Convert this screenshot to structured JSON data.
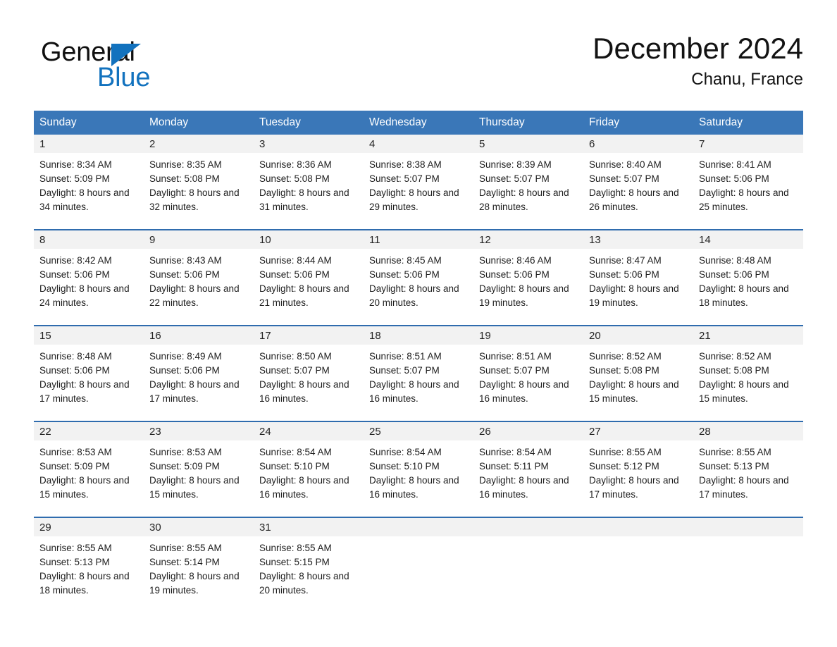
{
  "brand": {
    "word_one": "General",
    "word_two": "Blue",
    "triangle_color": "#1272be"
  },
  "header": {
    "title": "December 2024",
    "subtitle": "Chanu, France"
  },
  "theme": {
    "header_blue": "#3a77b8",
    "row_rule_blue": "#2f6cae",
    "daynum_band": "#f2f2f2"
  },
  "weekdays": [
    "Sunday",
    "Monday",
    "Tuesday",
    "Wednesday",
    "Thursday",
    "Friday",
    "Saturday"
  ],
  "weeks": [
    [
      {
        "day": "1",
        "info": "Sunrise: 8:34 AM\nSunset: 5:09 PM\nDaylight: 8 hours and 34 minutes."
      },
      {
        "day": "2",
        "info": "Sunrise: 8:35 AM\nSunset: 5:08 PM\nDaylight: 8 hours and 32 minutes."
      },
      {
        "day": "3",
        "info": "Sunrise: 8:36 AM\nSunset: 5:08 PM\nDaylight: 8 hours and 31 minutes."
      },
      {
        "day": "4",
        "info": "Sunrise: 8:38 AM\nSunset: 5:07 PM\nDaylight: 8 hours and 29 minutes."
      },
      {
        "day": "5",
        "info": "Sunrise: 8:39 AM\nSunset: 5:07 PM\nDaylight: 8 hours and 28 minutes."
      },
      {
        "day": "6",
        "info": "Sunrise: 8:40 AM\nSunset: 5:07 PM\nDaylight: 8 hours and 26 minutes."
      },
      {
        "day": "7",
        "info": "Sunrise: 8:41 AM\nSunset: 5:06 PM\nDaylight: 8 hours and 25 minutes."
      }
    ],
    [
      {
        "day": "8",
        "info": "Sunrise: 8:42 AM\nSunset: 5:06 PM\nDaylight: 8 hours and 24 minutes."
      },
      {
        "day": "9",
        "info": "Sunrise: 8:43 AM\nSunset: 5:06 PM\nDaylight: 8 hours and 22 minutes."
      },
      {
        "day": "10",
        "info": "Sunrise: 8:44 AM\nSunset: 5:06 PM\nDaylight: 8 hours and 21 minutes."
      },
      {
        "day": "11",
        "info": "Sunrise: 8:45 AM\nSunset: 5:06 PM\nDaylight: 8 hours and 20 minutes."
      },
      {
        "day": "12",
        "info": "Sunrise: 8:46 AM\nSunset: 5:06 PM\nDaylight: 8 hours and 19 minutes."
      },
      {
        "day": "13",
        "info": "Sunrise: 8:47 AM\nSunset: 5:06 PM\nDaylight: 8 hours and 19 minutes."
      },
      {
        "day": "14",
        "info": "Sunrise: 8:48 AM\nSunset: 5:06 PM\nDaylight: 8 hours and 18 minutes."
      }
    ],
    [
      {
        "day": "15",
        "info": "Sunrise: 8:48 AM\nSunset: 5:06 PM\nDaylight: 8 hours and 17 minutes."
      },
      {
        "day": "16",
        "info": "Sunrise: 8:49 AM\nSunset: 5:06 PM\nDaylight: 8 hours and 17 minutes."
      },
      {
        "day": "17",
        "info": "Sunrise: 8:50 AM\nSunset: 5:07 PM\nDaylight: 8 hours and 16 minutes."
      },
      {
        "day": "18",
        "info": "Sunrise: 8:51 AM\nSunset: 5:07 PM\nDaylight: 8 hours and 16 minutes."
      },
      {
        "day": "19",
        "info": "Sunrise: 8:51 AM\nSunset: 5:07 PM\nDaylight: 8 hours and 16 minutes."
      },
      {
        "day": "20",
        "info": "Sunrise: 8:52 AM\nSunset: 5:08 PM\nDaylight: 8 hours and 15 minutes."
      },
      {
        "day": "21",
        "info": "Sunrise: 8:52 AM\nSunset: 5:08 PM\nDaylight: 8 hours and 15 minutes."
      }
    ],
    [
      {
        "day": "22",
        "info": "Sunrise: 8:53 AM\nSunset: 5:09 PM\nDaylight: 8 hours and 15 minutes."
      },
      {
        "day": "23",
        "info": "Sunrise: 8:53 AM\nSunset: 5:09 PM\nDaylight: 8 hours and 15 minutes."
      },
      {
        "day": "24",
        "info": "Sunrise: 8:54 AM\nSunset: 5:10 PM\nDaylight: 8 hours and 16 minutes."
      },
      {
        "day": "25",
        "info": "Sunrise: 8:54 AM\nSunset: 5:10 PM\nDaylight: 8 hours and 16 minutes."
      },
      {
        "day": "26",
        "info": "Sunrise: 8:54 AM\nSunset: 5:11 PM\nDaylight: 8 hours and 16 minutes."
      },
      {
        "day": "27",
        "info": "Sunrise: 8:55 AM\nSunset: 5:12 PM\nDaylight: 8 hours and 17 minutes."
      },
      {
        "day": "28",
        "info": "Sunrise: 8:55 AM\nSunset: 5:13 PM\nDaylight: 8 hours and 17 minutes."
      }
    ],
    [
      {
        "day": "29",
        "info": "Sunrise: 8:55 AM\nSunset: 5:13 PM\nDaylight: 8 hours and 18 minutes."
      },
      {
        "day": "30",
        "info": "Sunrise: 8:55 AM\nSunset: 5:14 PM\nDaylight: 8 hours and 19 minutes."
      },
      {
        "day": "31",
        "info": "Sunrise: 8:55 AM\nSunset: 5:15 PM\nDaylight: 8 hours and 20 minutes."
      },
      {
        "day": "",
        "info": ""
      },
      {
        "day": "",
        "info": ""
      },
      {
        "day": "",
        "info": ""
      },
      {
        "day": "",
        "info": ""
      }
    ]
  ]
}
